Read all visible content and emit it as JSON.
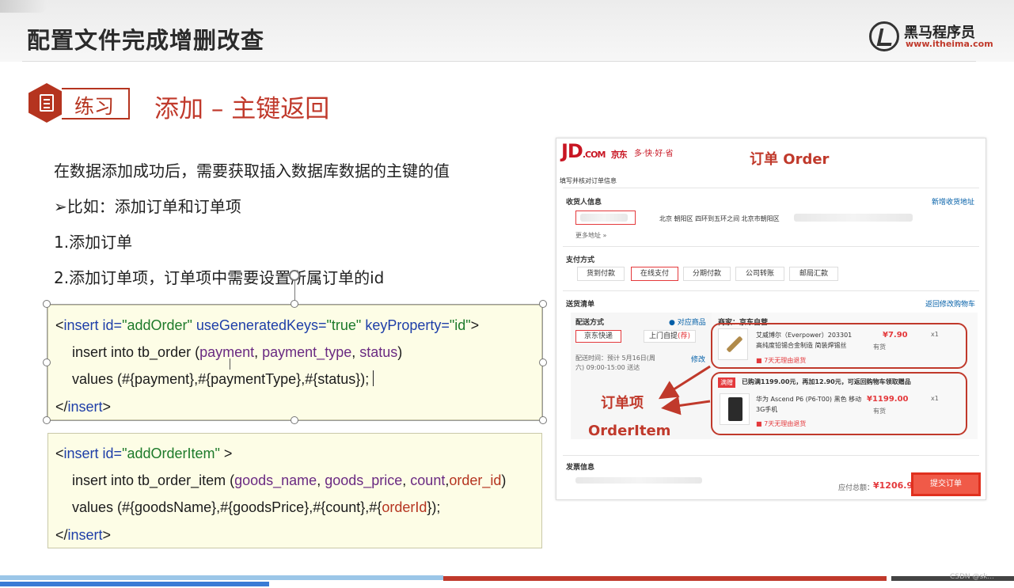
{
  "slide": {
    "title": "配置文件完成增删改查",
    "logo_name": "黑马程序员",
    "logo_url": "www.itheima.com",
    "exercise_tag": "练习",
    "exercise_title": "添加 – 主键返回"
  },
  "body": {
    "line1": "在数据添加成功后，需要获取插入数据库数据的主键的值",
    "line2": "➢比如：添加订单和订单项",
    "line3": "1.添加订单",
    "line4": "2.添加订单项，订单项中需要设置所属订单的id"
  },
  "code1": {
    "l1_open": "<",
    "l1_tag": "insert",
    "l1_id_attr": " id=",
    "l1_id_val": "\"addOrder\"",
    "l1_ugk_attr": " useGeneratedKeys=",
    "l1_ugk_val": "\"true\"",
    "l1_kp_attr": " keyProperty=",
    "l1_kp_val": "\"id\"",
    "l1_close": ">",
    "l2_sql": "insert into tb_order (",
    "l2_c1": "payment",
    "l2_sep1": ", ",
    "l2_c2": "payment_type",
    "l2_sep2": ", ",
    "l2_c3": "status",
    "l2_end": ")",
    "l3": "values (#{payment},#{paymentType},#{status});",
    "l4_open": "</",
    "l4_tag": "insert",
    "l4_close": ">"
  },
  "code2": {
    "l1_open": "<",
    "l1_tag": "insert",
    "l1_id_attr": " id=",
    "l1_id_val": "\"addOrderItem\"",
    "l1_close": " >",
    "l2_sql": "insert into tb_order_item (",
    "l2_c1": "goods_name",
    "l2_sep1": ", ",
    "l2_c2": "goods_price",
    "l2_sep2": ", ",
    "l2_c3": "count",
    "l2_sep3": ",",
    "l2_c4": "order_id",
    "l2_end": ")",
    "l3_pre": "values (#{goodsName},#{goodsPrice},#{count},#{",
    "l3_oid": "orderId",
    "l3_end": "});",
    "l4_open": "</",
    "l4_tag": "insert",
    "l4_close": ">"
  },
  "jd": {
    "logo": "JD",
    "logo_com": ".COM",
    "logo_cn": "京东",
    "slogan": "多·快·好·省",
    "page_heading": "填写并核对订单信息",
    "annotation_order": "订单 Order",
    "receiver_title": "收货人信息",
    "add_address": "新增收货地址",
    "address_text": "北京 朝阳区 四环到五环之间 北京市朝阳区",
    "more_address": "更多地址 »",
    "payment_title": "支付方式",
    "payment_options": [
      "货到付款",
      "在线支付",
      "分期付款",
      "公司转账",
      "邮局汇款"
    ],
    "shipping_title": "送货清单",
    "back_to_cart": "返回修改购物车",
    "delivery_method": "配送方式",
    "goods_link": "对应商品",
    "seller": "商家：京东自营",
    "ship_jd": "京东快递",
    "ship_pickup": "上门自提",
    "ship_pickup_tag": "(荐)",
    "ship_time": "配送时间：预计 5月16日(周六) 09:00-15:00 送达",
    "ship_modify": "修改",
    "item1_name": "艾威博尔（Everpower）203301 高纯度铅锡合金制造 简装焊锡丝",
    "item1_price": "¥7.90",
    "item1_qty": "x1",
    "item1_stock": "有货",
    "item1_return": "7天无理由退货",
    "promo_tag": "满赠",
    "promo_text": "已购满1199.00元，再加12.90元，可返回购物车领取赠品",
    "item2_name": "华为 Ascend P6 (P6-T00) 黑色 移动3G手机",
    "item2_price": "¥1199.00",
    "item2_qty": "x1",
    "item2_stock": "有货",
    "item2_return": "7天无理由退货",
    "annotation_item_cn": "订单项",
    "annotation_item_en": "OrderItem",
    "invoice_title": "发票信息",
    "total_label": "应付总额：",
    "total_value": "¥1206.90",
    "submit": "提交订单"
  },
  "watermark": "CSDN @sk..."
}
